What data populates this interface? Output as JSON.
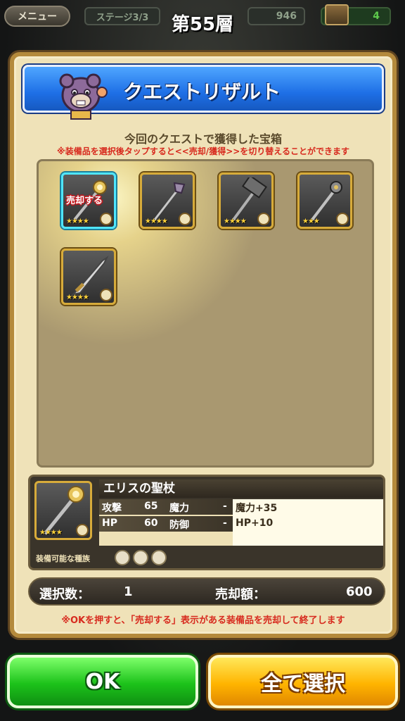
{
  "topbar": {
    "menu_label": "メニュー",
    "stage_label": "ステージ3/3",
    "floor_title": "第55層",
    "coins": "946",
    "chests": "4"
  },
  "panel": {
    "title": "クエストリザルト",
    "subtitle": "今回のクエストで獲得した宝箱",
    "note": "※装備品を選択後タップすると<<売却/獲得>>を切り替えることができます"
  },
  "items": [
    {
      "kind": "staff",
      "stars": "★★★★",
      "sell_tag": "売却する",
      "selected": true
    },
    {
      "kind": "staff",
      "stars": "★★★★"
    },
    {
      "kind": "hammer",
      "stars": "★★★★"
    },
    {
      "kind": "mace",
      "stars": "★★★"
    },
    {
      "kind": "sword",
      "stars": "★★★★"
    }
  ],
  "detail": {
    "name": "エリスの聖杖",
    "stars": "★★★★",
    "stats": {
      "attack_label": "攻撃",
      "attack_value": "65",
      "magic_label": "魔力",
      "magic_value": "-",
      "hp_label": "HP",
      "hp_value": "60",
      "defense_label": "防御",
      "defense_value": "-"
    },
    "effects": [
      "魔力+35",
      "HP+10"
    ],
    "equip_label": "装備可能な種族"
  },
  "summary": {
    "count_label": "選択数：",
    "count_value": "1",
    "price_label": "売却額：",
    "price_value": "600"
  },
  "bottom_note": "※OKを押すと、「売却する」表示がある装備品を売却して終了します",
  "buttons": {
    "ok_label": "OK",
    "select_all_label": "全て選択"
  },
  "colors": {
    "panel_bg": "#efe2b8",
    "header_blue": "#1e6fe6",
    "note_red": "#d72a1e",
    "ok_green": "#1cc21a",
    "select_all_orange": "#ffb400"
  }
}
